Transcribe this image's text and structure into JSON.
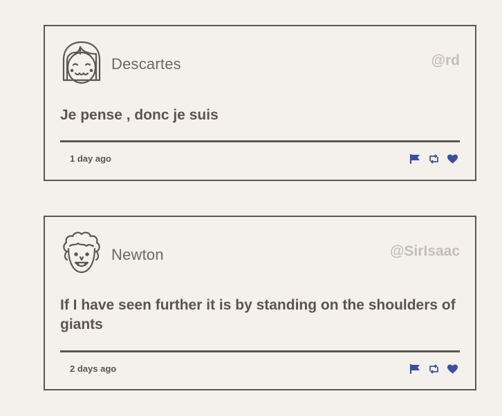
{
  "tweets": [
    {
      "author": "Descartes",
      "handle": "@rd",
      "message": "Je pense , donc je suis",
      "timestamp": "1 day ago",
      "avatar_icon": "girl-face-icon"
    },
    {
      "author": "Newton",
      "handle": "@SirIsaac",
      "message": "If I have seen further it is by standing on the shoulders of giants",
      "timestamp": "2 days ago",
      "avatar_icon": "curly-hair-face-icon"
    }
  ],
  "icons": {
    "flag": "flag-icon",
    "retweet": "retweet-icon",
    "like": "heart-icon"
  },
  "colors": {
    "background": "#f4f1ed",
    "border": "#5b5650",
    "text": "#5b544c",
    "handle": "#c4beb7",
    "action": "#3d4f9c"
  }
}
